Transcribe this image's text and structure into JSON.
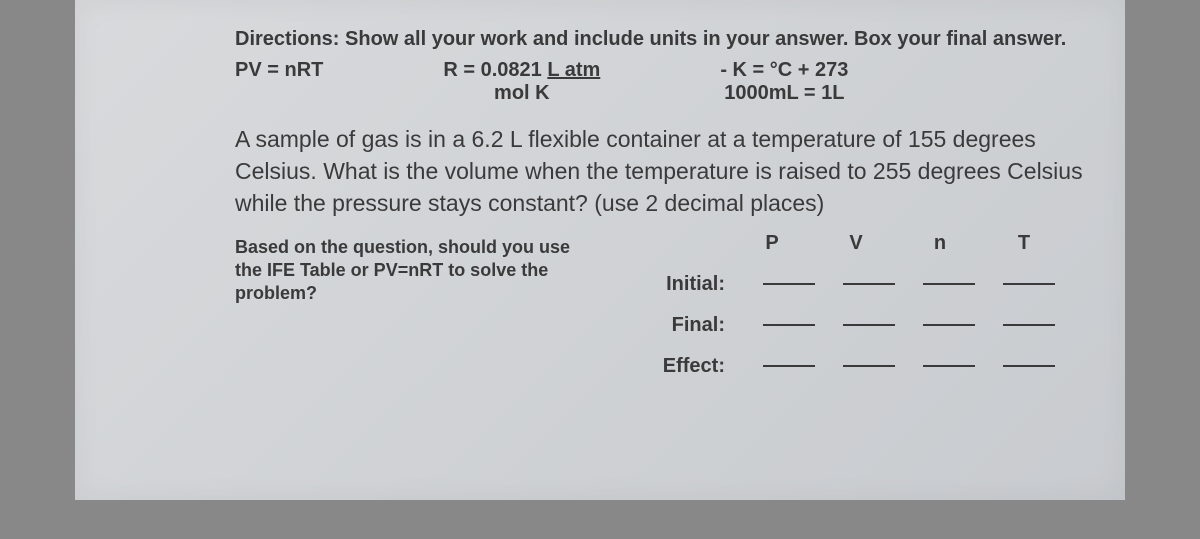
{
  "directions": "Directions:  Show all your work and include units in your answer. Box your final answer.",
  "formulas": {
    "pv": "PV = nRT",
    "r_top": "R = 0.0821 L atm",
    "r_bottom": "mol K",
    "k_top": "- K = °C + 273",
    "k_bottom": "1000mL = 1L"
  },
  "problem": "A sample of gas is in a 6.2 L flexible container at a temperature of 155 degrees Celsius.  What is the volume when the temperature is raised to 255 degrees Celsius while the pressure stays constant? (use 2 decimal places)",
  "prompt": "Based on the question, should you use the IFE Table or PV=nRT to solve the problem?",
  "ife": {
    "headers": [
      "P",
      "V",
      "n",
      "T"
    ],
    "rows": [
      "Initial:",
      "Final:",
      "Effect:"
    ]
  }
}
